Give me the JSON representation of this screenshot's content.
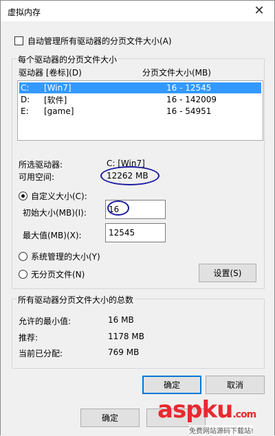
{
  "window": {
    "title": "虚拟内存"
  },
  "auto_manage": {
    "label": "自动管理所有驱动器的分页文件大小(A)",
    "checked": false
  },
  "per_drive": {
    "group_label": "每个驱动器的分页文件大小",
    "col_drive": "驱动器 [卷标](D)",
    "col_size": "分页文件大小(MB)",
    "rows": [
      {
        "drive": "C:",
        "label": "[Win7]",
        "size": "16 - 12545",
        "selected": true
      },
      {
        "drive": "D:",
        "label": "[软件]",
        "size": "16 - 142009",
        "selected": false
      },
      {
        "drive": "E:",
        "label": "[game]",
        "size": "16 - 54951",
        "selected": false
      }
    ],
    "selected_drive_label": "所选驱动器:",
    "selected_drive_value": "C:  [Win7]",
    "free_space_label": "可用空间:",
    "free_space_value": "12262 MB",
    "custom_size_label": "自定义大小(C):",
    "initial_size_label": "初始大小(MB)(I):",
    "initial_size_value": "16",
    "max_size_label": "最大值(MB)(X):",
    "max_size_value": "12545",
    "system_managed_label": "系统管理的大小(Y)",
    "no_paging_label": "无分页文件(N)",
    "set_button": "设置(S)"
  },
  "totals": {
    "group_label": "所有驱动器分页文件大小的总数",
    "min_allowed_label": "允许的最小值:",
    "min_allowed_value": "16 MB",
    "recommended_label": "推荐:",
    "recommended_value": "1178 MB",
    "current_label": "当前已分配:",
    "current_value": "769 MB"
  },
  "dialog_buttons": {
    "ok": "确定",
    "cancel": "取消"
  },
  "background_buttons": {
    "ok": "确定"
  },
  "watermark": {
    "main": "aspku",
    "suffix": ".com",
    "sub": "免费网站源码下载站!"
  },
  "colors": {
    "selection": "#3399ff",
    "annotation": "#1a1aa0",
    "watermark": "#e8292f"
  }
}
